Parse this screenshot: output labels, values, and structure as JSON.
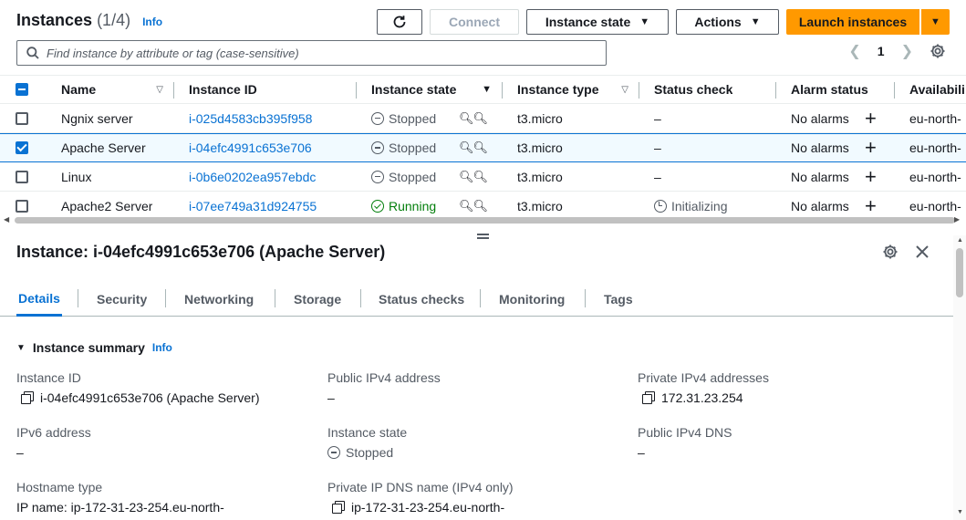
{
  "header": {
    "title": "Instances",
    "count": "(1/4)",
    "info": "Info",
    "refresh_icon": "refresh-icon",
    "connect": "Connect",
    "instance_state": "Instance state",
    "actions": "Actions",
    "launch": "Launch instances",
    "search_placeholder": "Find instance by attribute or tag (case-sensitive)",
    "page": "1"
  },
  "table": {
    "columns": [
      "Name",
      "Instance ID",
      "Instance state",
      "Instance type",
      "Status check",
      "Alarm status",
      "Availabili"
    ],
    "rows": [
      {
        "name": "Ngnix server",
        "id": "i-025d4583cb395f958",
        "state": "Stopped",
        "type": "t3.micro",
        "status": "–",
        "alarm": "No alarms",
        "az": "eu-north-",
        "selected": false
      },
      {
        "name": "Apache Server",
        "id": "i-04efc4991c653e706",
        "state": "Stopped",
        "type": "t3.micro",
        "status": "–",
        "alarm": "No alarms",
        "az": "eu-north-",
        "selected": true
      },
      {
        "name": "Linux",
        "id": "i-0b6e0202ea957ebdc",
        "state": "Stopped",
        "type": "t3.micro",
        "status": "–",
        "alarm": "No alarms",
        "az": "eu-north-",
        "selected": false
      },
      {
        "name": "Apache2 Server",
        "id": "i-07ee749a31d924755",
        "state": "Running",
        "type": "t3.micro",
        "status": "Initializing",
        "alarm": "No alarms",
        "az": "eu-north-",
        "selected": false
      }
    ]
  },
  "details": {
    "title": "Instance: i-04efc4991c653e706 (Apache Server)",
    "tabs": [
      "Details",
      "Security",
      "Networking",
      "Storage",
      "Status checks",
      "Monitoring",
      "Tags"
    ],
    "section": "Instance summary",
    "section_info": "Info",
    "fields": {
      "instance_id_label": "Instance ID",
      "instance_id_value": "i-04efc4991c653e706 (Apache Server)",
      "public_ipv4_label": "Public IPv4 address",
      "public_ipv4_value": "–",
      "private_ipv4_label": "Private IPv4 addresses",
      "private_ipv4_value": "172.31.23.254",
      "ipv6_label": "IPv6 address",
      "ipv6_value": "–",
      "state_label": "Instance state",
      "state_value": "Stopped",
      "public_dns_label": "Public IPv4 DNS",
      "public_dns_value": "–",
      "hostname_label": "Hostname type",
      "hostname_value": "IP name: ip-172-31-23-254.eu-north-",
      "private_dns_label": "Private IP DNS name (IPv4 only)",
      "private_dns_value": "ip-172-31-23-254.eu-north-"
    }
  },
  "colors": {
    "accent": "#0972d3",
    "primary_button": "#ff9900",
    "running": "#037f0c",
    "stopped": "#545b64"
  }
}
